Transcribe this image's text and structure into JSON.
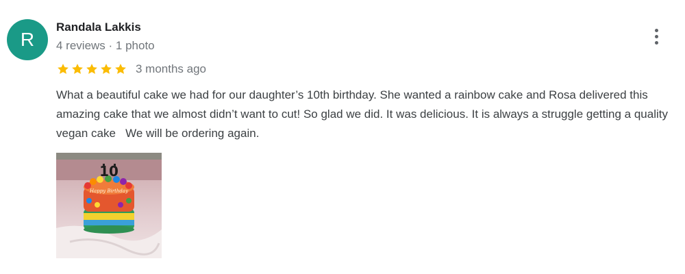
{
  "author": {
    "initial": "R",
    "name": "Randala Lakkis",
    "meta": "4 reviews · 1 photo",
    "avatar_color": "#1a9a87"
  },
  "rating": {
    "stars": 5,
    "max": 5,
    "star_color": "#fbbc04",
    "date": "3 months ago"
  },
  "review": {
    "text": "What a beautiful cake we had for our daughter’s 10th birthday. She wanted a rainbow cake and Rosa delivered this amazing cake that we almost didn’t want to cut! So glad we did. It was delicious. It is always a struggle getting a quality vegan cake   We will be ordering again."
  },
  "menu": {
    "icon": "more-vert-icon"
  },
  "photo": {
    "topper_text": "10",
    "cake_writing": "Happy Birthday"
  }
}
